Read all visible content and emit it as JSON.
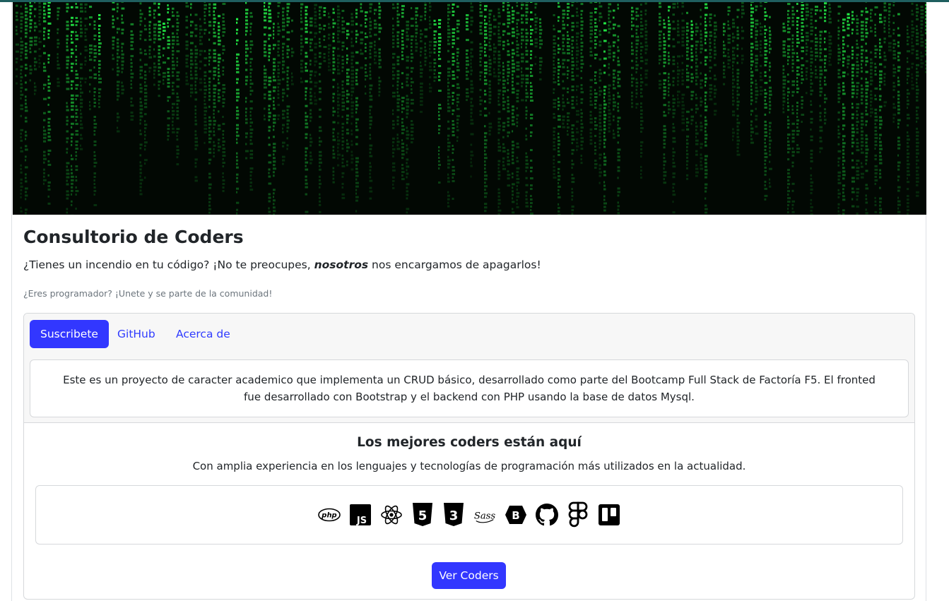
{
  "hero": {
    "image_name": "matrix-code-rain"
  },
  "header": {
    "title": "Consultorio de Coders",
    "lead_before": "¿Tienes un incendio en tu código? ¡No te preocupes, ",
    "lead_emphasis": "nosotros",
    "lead_after": " nos encargamos de apagarlos!",
    "join_text": "¿Eres programador? ¡Unete y se parte de la comunidad!"
  },
  "tabs": [
    {
      "label": "Suscribete",
      "active": true
    },
    {
      "label": "GitHub",
      "active": false
    },
    {
      "label": "Acerca de",
      "active": false
    }
  ],
  "about_text": "Este es un proyecto de caracter academico que implementa un CRUD básico, desarrollado como parte del Bootcamp Full Stack de Factoría F5. El fronted fue desarrollado con Bootstrap y el backend con PHP usando la base de datos Mysql.",
  "section": {
    "title": "Los mejores coders están aquí",
    "subtitle": "Con amplia experiencia en los lenguajes y tecnologías de programación más utilizados en la actualidad."
  },
  "tech_icons": [
    "php-icon",
    "javascript-icon",
    "react-icon",
    "html5-icon",
    "css3-icon",
    "sass-icon",
    "bootstrap-icon",
    "github-icon",
    "figma-icon",
    "trello-icon"
  ],
  "php_label": "php",
  "js_label": "JS",
  "html_label": "5",
  "css_label": "3",
  "sass_label": "Sass",
  "bootstrap_label": "B",
  "cta_label": "Ver Coders",
  "colors": {
    "primary": "#3237ff",
    "hero_green": "#22c544"
  }
}
